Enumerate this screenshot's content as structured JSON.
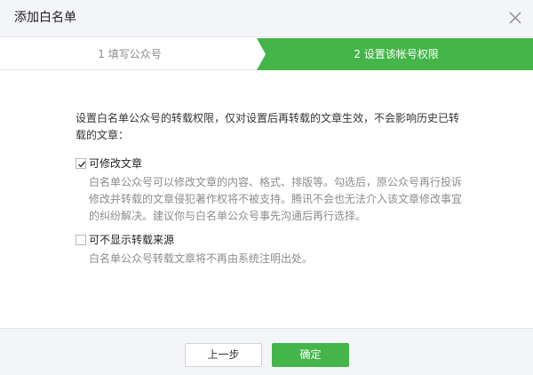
{
  "dialog": {
    "title": "添加白名单",
    "close_icon": "close-icon"
  },
  "steps": [
    {
      "label": "1 填写公众号",
      "state": "completed"
    },
    {
      "label": "2 设置该帐号权限",
      "state": "active"
    }
  ],
  "intro_text": "设置白名单公众号的转载权限，仅对设置后再转载的文章生效，不会影响历史已转载的文章：",
  "options": [
    {
      "label": "可修改文章",
      "checked": true,
      "description": "白名单公众号可以修改文章的内容、格式、排版等。勾选后，原公众号再行投诉修改并转载的文章侵犯著作权将不被支持。腾讯不会也无法介入该文章修改事宜的纠纷解决。建议你与白名单公众号事先沟通后再行选择。"
    },
    {
      "label": "可不显示转载来源",
      "checked": false,
      "description": "白名单公众号转载文章将不再由系统注明出处。"
    }
  ],
  "footer": {
    "prev_label": "上一步",
    "ok_label": "确定"
  },
  "colors": {
    "accent": "#44b549",
    "header_bg": "#f4f5f9",
    "muted_text": "#8d8d8d"
  }
}
